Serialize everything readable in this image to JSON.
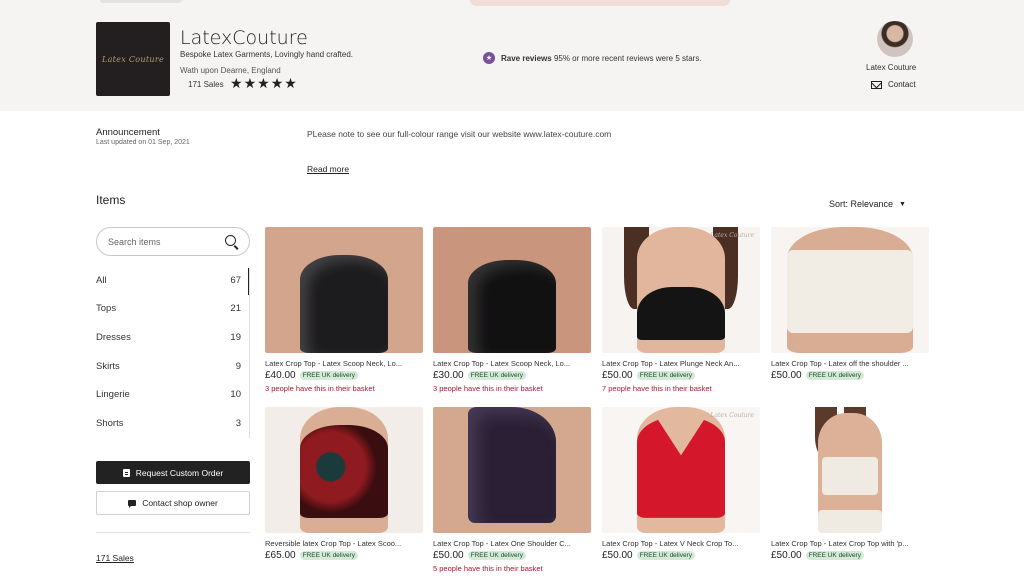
{
  "shop": {
    "logo_text": "Latex Couture",
    "name": "LatexCouture",
    "tagline": "Bespoke Latex Garments, Lovingly hand crafted.",
    "location": "Wath upon Dearne, England",
    "sales": "171 Sales",
    "stars": [
      "★",
      "★",
      "★",
      "★",
      "★"
    ],
    "rave_label": "Rave reviews",
    "rave_detail": "95% or more recent reviews were 5 stars.",
    "owner_name": "Latex Couture",
    "contact_label": "Contact"
  },
  "announcement": {
    "title": "Announcement",
    "updated": "Last updated on 01 Sep, 2021",
    "text": "PLease note to see our full-colour range visit our website www.latex-couture.com",
    "read_more": "Read more"
  },
  "items": {
    "heading": "Items",
    "sort_label": "Sort: Relevance",
    "search_placeholder": "Search items"
  },
  "categories": [
    {
      "name": "All",
      "count": "67"
    },
    {
      "name": "Tops",
      "count": "21"
    },
    {
      "name": "Dresses",
      "count": "19"
    },
    {
      "name": "Skirts",
      "count": "9"
    },
    {
      "name": "Lingerie",
      "count": "10"
    },
    {
      "name": "Shorts",
      "count": "3"
    }
  ],
  "sidebar": {
    "request_custom": "Request Custom Order",
    "contact_owner": "Contact shop owner",
    "sales_link": "171 Sales"
  },
  "products": [
    {
      "title": "Latex Crop Top - Latex Scoop Neck, Lo...",
      "price": "£40.00",
      "badge": "FREE UK delivery",
      "note": "3 people have this in their basket",
      "color": "#1c1b1d"
    },
    {
      "title": "Latex Crop Top - Latex Scoop Neck, Lo...",
      "price": "£30.00",
      "badge": "FREE UK delivery",
      "note": "3 people have this in their basket",
      "color": "#121112"
    },
    {
      "title": "Latex Crop Top - Latex Plunge Neck An...",
      "price": "£50.00",
      "badge": "FREE UK delivery",
      "note": "7 people have this in their basket",
      "color": "#151414"
    },
    {
      "title": "Latex Crop Top - Latex off the shoulder ...",
      "price": "£50.00",
      "badge": "FREE UK delivery",
      "note": "",
      "color": "#f1ece4"
    },
    {
      "title": "Reversible latex Crop Top - Latex Scoo...",
      "price": "£65.00",
      "badge": "FREE UK delivery",
      "note": "",
      "color": "#8f1a1f"
    },
    {
      "title": "Latex Crop Top - Latex One Shoulder C...",
      "price": "£50.00",
      "badge": "FREE UK delivery",
      "note": "5 people have this in their basket",
      "color": "#2a1f34"
    },
    {
      "title": "Latex Crop Top - Latex V Neck Crop To...",
      "price": "£50.00",
      "badge": "FREE UK delivery",
      "note": "",
      "color": "#d4172a"
    },
    {
      "title": "Latex Crop Top - Latex Crop Top with 'p...",
      "price": "£50.00",
      "badge": "FREE UK delivery",
      "note": "",
      "color": "#f0ebe2"
    }
  ]
}
